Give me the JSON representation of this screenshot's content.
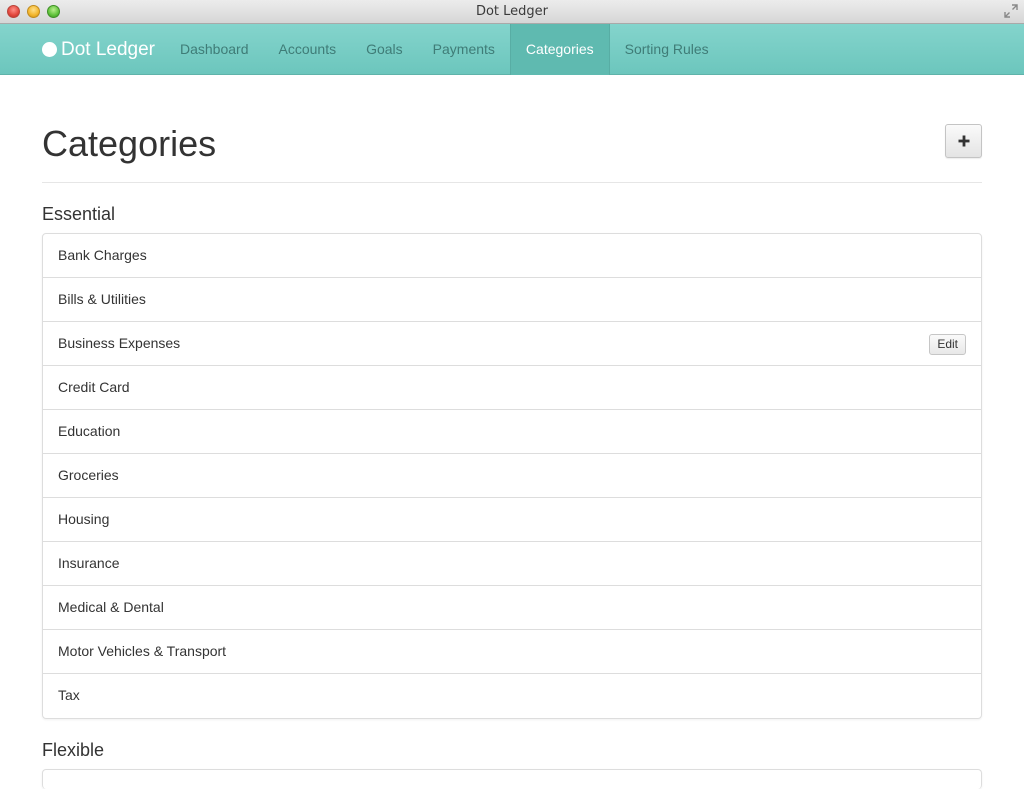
{
  "window": {
    "title": "Dot Ledger"
  },
  "navbar": {
    "brand": "Dot Ledger",
    "items": [
      {
        "label": "Dashboard",
        "active": false
      },
      {
        "label": "Accounts",
        "active": false
      },
      {
        "label": "Goals",
        "active": false
      },
      {
        "label": "Payments",
        "active": false
      },
      {
        "label": "Categories",
        "active": true
      },
      {
        "label": "Sorting Rules",
        "active": false
      }
    ]
  },
  "page": {
    "title": "Categories",
    "add_button_icon": "plus-icon"
  },
  "sections": [
    {
      "title": "Essential",
      "items": [
        {
          "label": "Bank Charges"
        },
        {
          "label": "Bills & Utilities"
        },
        {
          "label": "Business Expenses",
          "hover": true
        },
        {
          "label": "Credit Card"
        },
        {
          "label": "Education"
        },
        {
          "label": "Groceries"
        },
        {
          "label": "Housing"
        },
        {
          "label": "Insurance"
        },
        {
          "label": "Medical & Dental"
        },
        {
          "label": "Motor Vehicles & Transport"
        },
        {
          "label": "Tax"
        }
      ]
    },
    {
      "title": "Flexible",
      "items": []
    }
  ],
  "edit_label": "Edit",
  "colors": {
    "navbar": "#6cc6bd",
    "nav_active": "#5fbab0",
    "nav_text": "#3f7c77"
  }
}
